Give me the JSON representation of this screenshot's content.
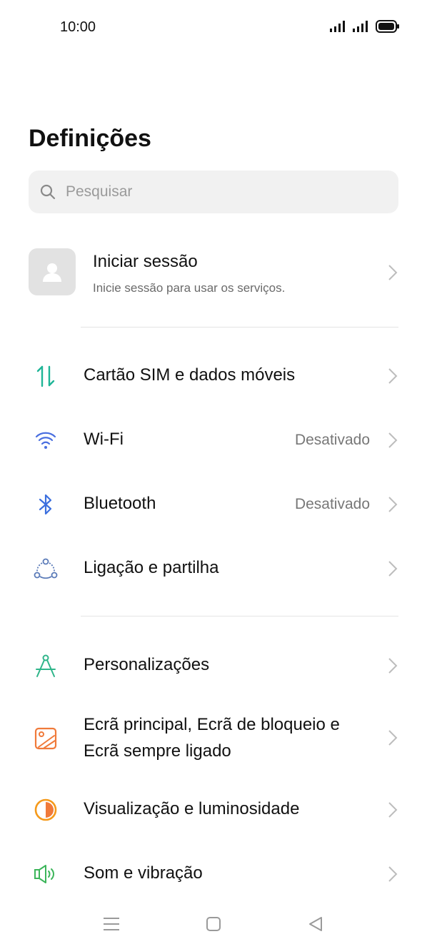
{
  "status_bar": {
    "time": "10:00",
    "icons": [
      "signal-icon",
      "signal-icon",
      "battery-icon"
    ]
  },
  "title": "Definições",
  "search": {
    "placeholder": "Pesquisar",
    "icon": "search-icon"
  },
  "account": {
    "title": "Iniciar sessão",
    "subtitle": "Inicie sessão para usar os serviços.",
    "icon": "person-icon"
  },
  "items": [
    {
      "label": "Cartão SIM e dados móveis",
      "icon": "sim-data-icon",
      "color": "#1fb597"
    },
    {
      "label": "Wi-Fi",
      "value": "Desativado",
      "icon": "wifi-icon",
      "color": "#4a6fe0"
    },
    {
      "label": "Bluetooth",
      "value": "Desativado",
      "icon": "bluetooth-icon",
      "color": "#3b6fde"
    },
    {
      "label": "Ligação e partilha",
      "icon": "connection-sharing-icon",
      "color": "#5a7ab8"
    },
    {
      "label": "Personalizações",
      "icon": "compass-icon",
      "color": "#2fb58a"
    },
    {
      "label_line1": "Ecrã principal, Ecrã de bloqueio e",
      "label_line2": "Ecrã sempre ligado",
      "icon": "wallpaper-icon",
      "color": "#f07a3a"
    },
    {
      "label": "Visualização e luminosidade",
      "icon": "brightness-icon",
      "color": "#f59a1b"
    },
    {
      "label": "Som e vibração",
      "icon": "speaker-icon",
      "color": "#3cb55a"
    }
  ],
  "nav": [
    "menu-icon",
    "home-icon",
    "back-icon"
  ]
}
